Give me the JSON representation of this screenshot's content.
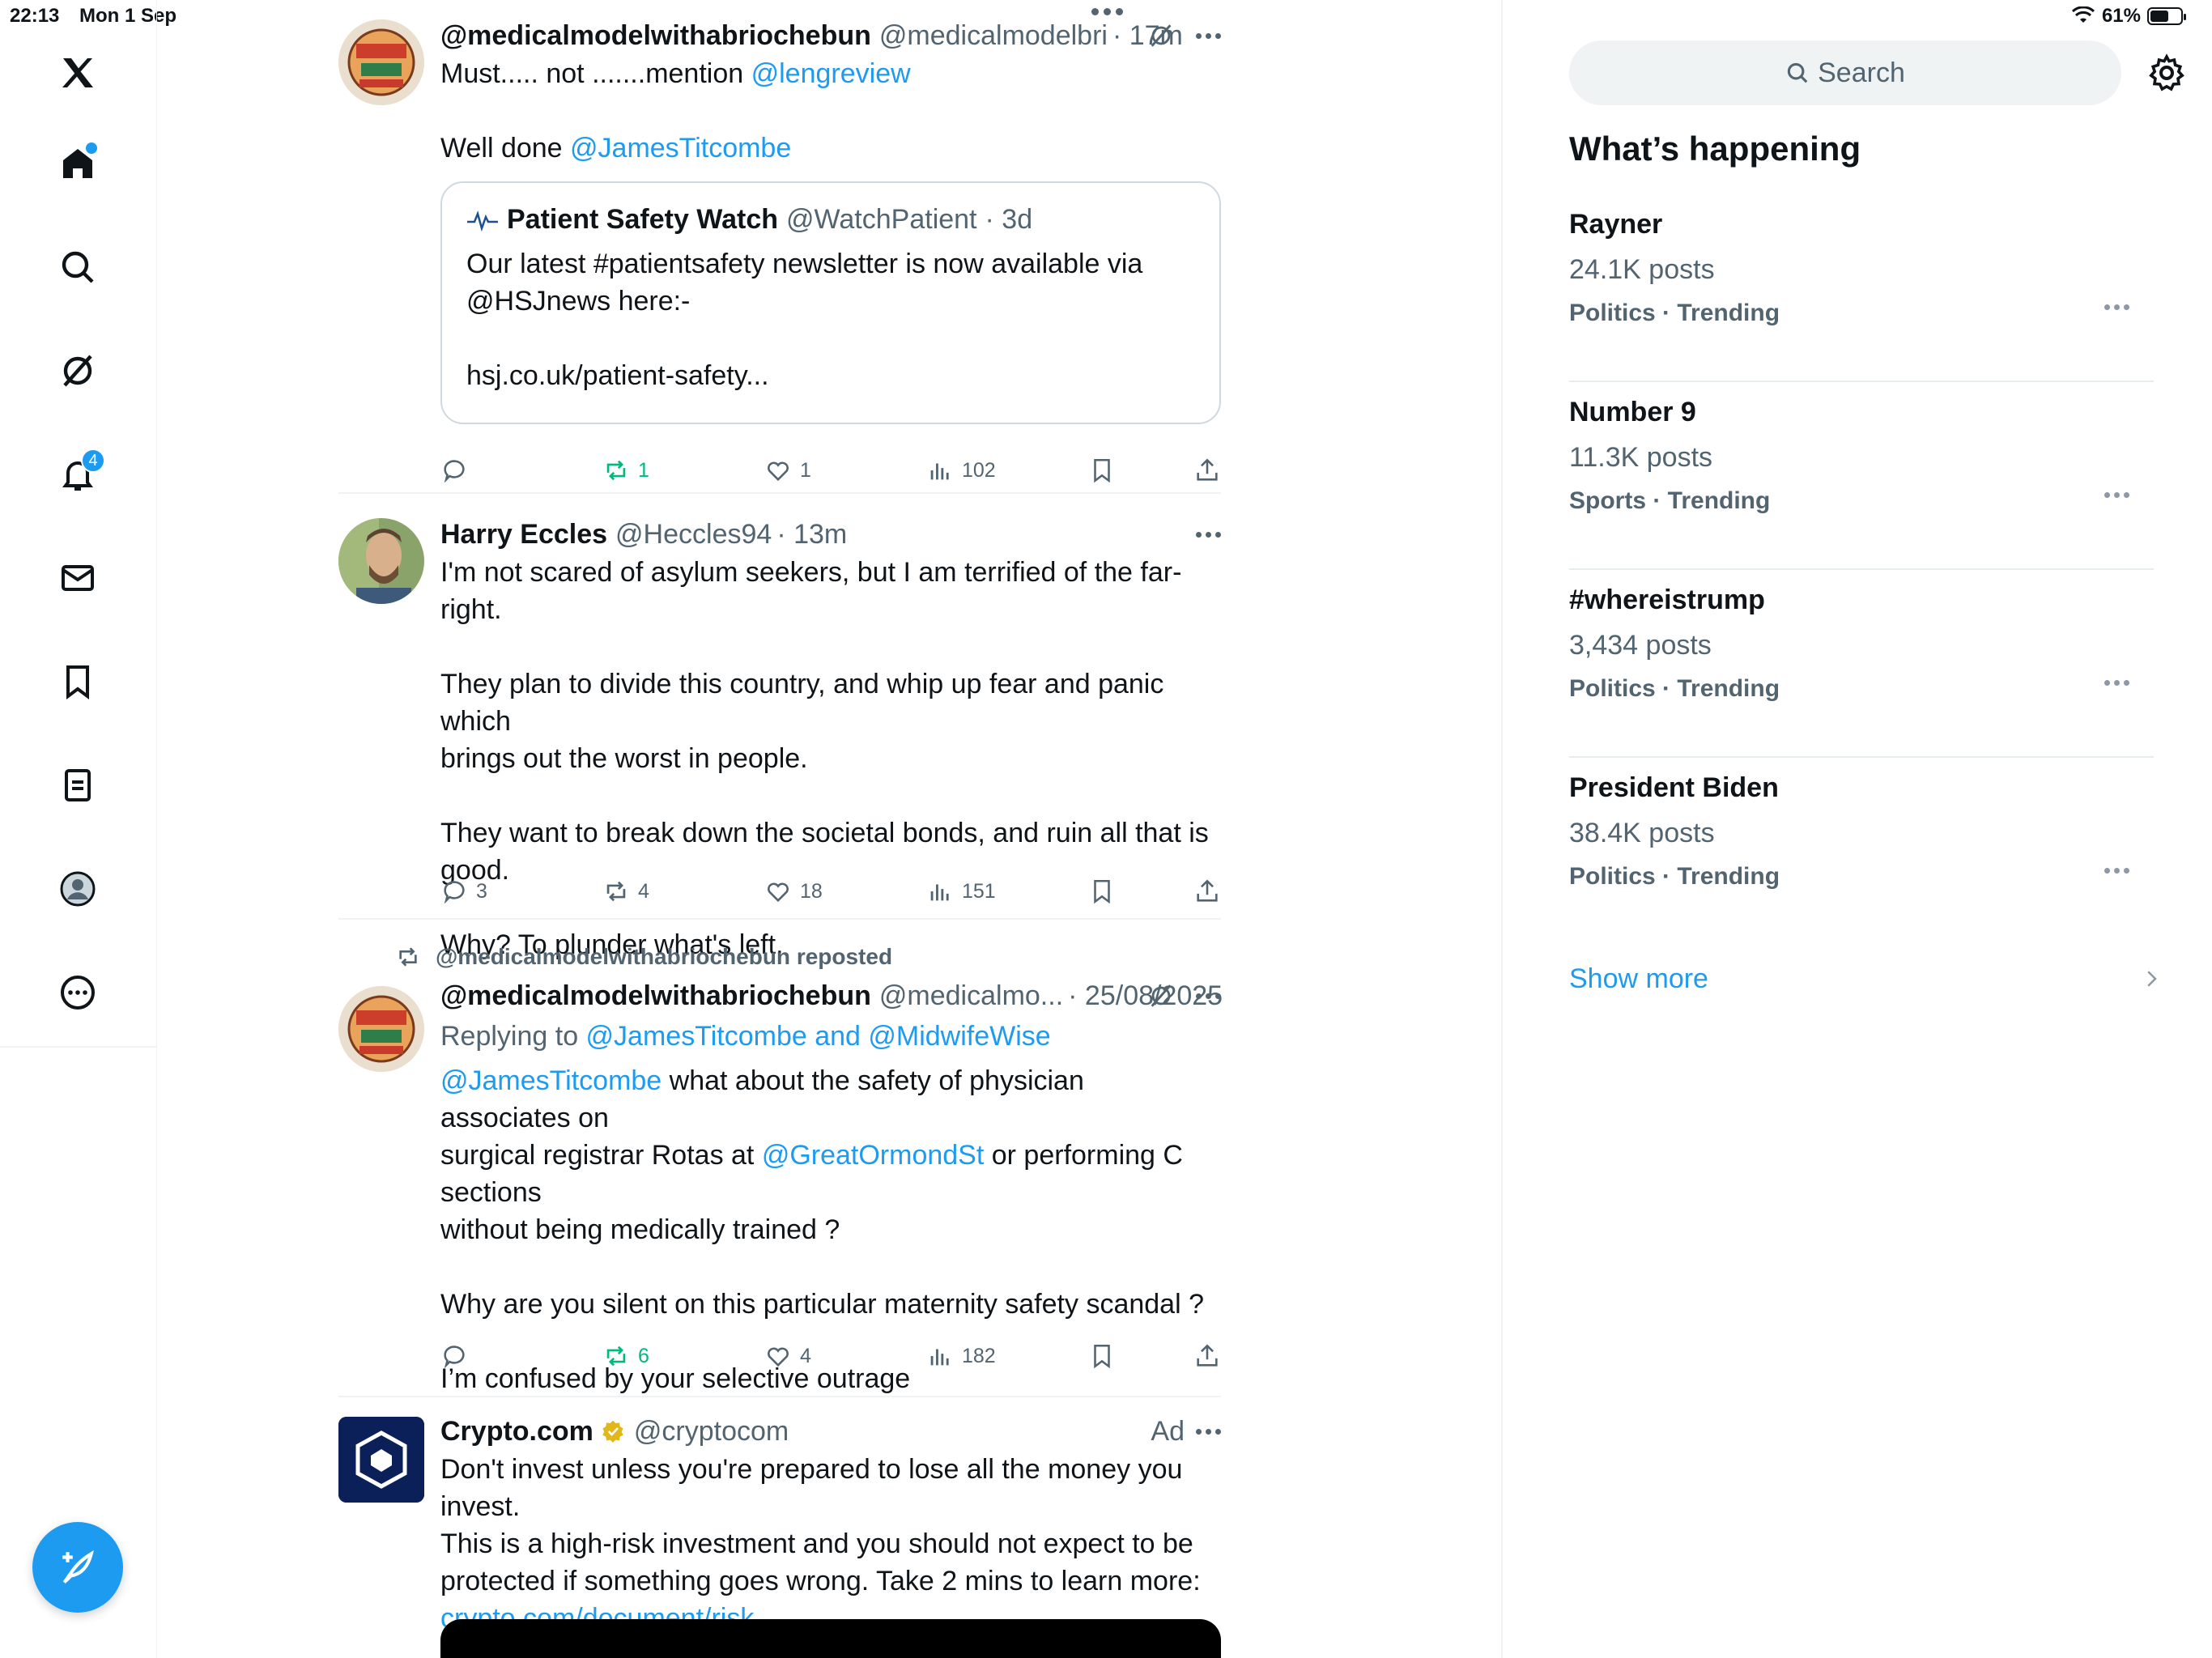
{
  "status_bar": {
    "time": "22:13",
    "date": "Mon 1 Sep",
    "battery": "61%",
    "battery_level": 0.61
  },
  "nav": {
    "notifications_badge": "4"
  },
  "posts": [
    {
      "name": "@medicalmodelwithabriochebun",
      "handle": "@medicalmodelbri",
      "time": "· 17m",
      "lines": [
        {
          "parts": [
            "Must..... not .......mention ",
            "@lengreview"
          ]
        },
        {
          "parts": [
            "Well done ",
            "@JamesTitcombe"
          ]
        }
      ],
      "quote": {
        "name": "Patient Safety Watch",
        "handle": "@WatchPatient",
        "time": "· 3d",
        "line1": "Our latest #patientsafety newsletter is now available via",
        "line2": "@HSJnews here:-",
        "line3": "hsj.co.uk/patient-safety..."
      },
      "actions": {
        "replies": "",
        "reposts": "1",
        "likes": "1",
        "views": "102"
      }
    },
    {
      "name": "Harry Eccles",
      "handle": "@Heccles94",
      "time": "· 13m",
      "text": [
        "I'm not scared of asylum seekers, but I am terrified of the far-right.",
        "They plan to divide this country, and whip up fear and panic which",
        "brings out the worst in people.",
        "They want to break down the societal bonds, and ruin all that is good.",
        "Why? To plunder what's left."
      ],
      "actions": {
        "replies": "3",
        "reposts": "4",
        "likes": "18",
        "views": "151"
      }
    },
    {
      "repost_by": "@medicalmodelwithabriochebun reposted",
      "name": "@medicalmodelwithabriochebun",
      "handle": "@medicalmo...",
      "time": "· 25/08/2025",
      "replying_label": "Replying to ",
      "replying_to": "@JamesTitcombe and @MidwifeWise",
      "text": {
        "l1a": "@JamesTitcombe",
        "l1b": " what about the safety of physician associates on",
        "l2a": "surgical registrar Rotas at ",
        "l2b": "@GreatOrmondSt",
        "l2c": " or performing C sections",
        "l3": "without being medically trained ?",
        "l4": "Why are you silent on this particular maternity safety scandal ?",
        "l5": "I’m confused by your selective outrage"
      },
      "actions": {
        "replies": "",
        "reposts": "6",
        "likes": "4",
        "views": "182"
      }
    },
    {
      "name": "Crypto.com",
      "handle": "@cryptocom",
      "ad_label": "Ad",
      "text": [
        "Don't invest unless you're prepared to lose all the money you invest.",
        "This is a high-risk investment and you should not expect to be",
        "protected if something goes wrong. Take 2 mins to learn more:"
      ],
      "link": "crypto.com/document/risk_..."
    }
  ],
  "sidebar": {
    "search_placeholder": "Search",
    "title": "What’s happening",
    "trends": [
      {
        "name": "Rayner",
        "count": "24.1K posts",
        "meta": "Politics · Trending"
      },
      {
        "name": "Number 9",
        "count": "11.3K posts",
        "meta": "Sports · Trending"
      },
      {
        "name": "#whereistrump",
        "count": "3,434 posts",
        "meta": "Politics · Trending"
      },
      {
        "name": "President Biden",
        "count": "38.4K posts",
        "meta": "Politics · Trending"
      }
    ],
    "show_more": "Show more"
  }
}
